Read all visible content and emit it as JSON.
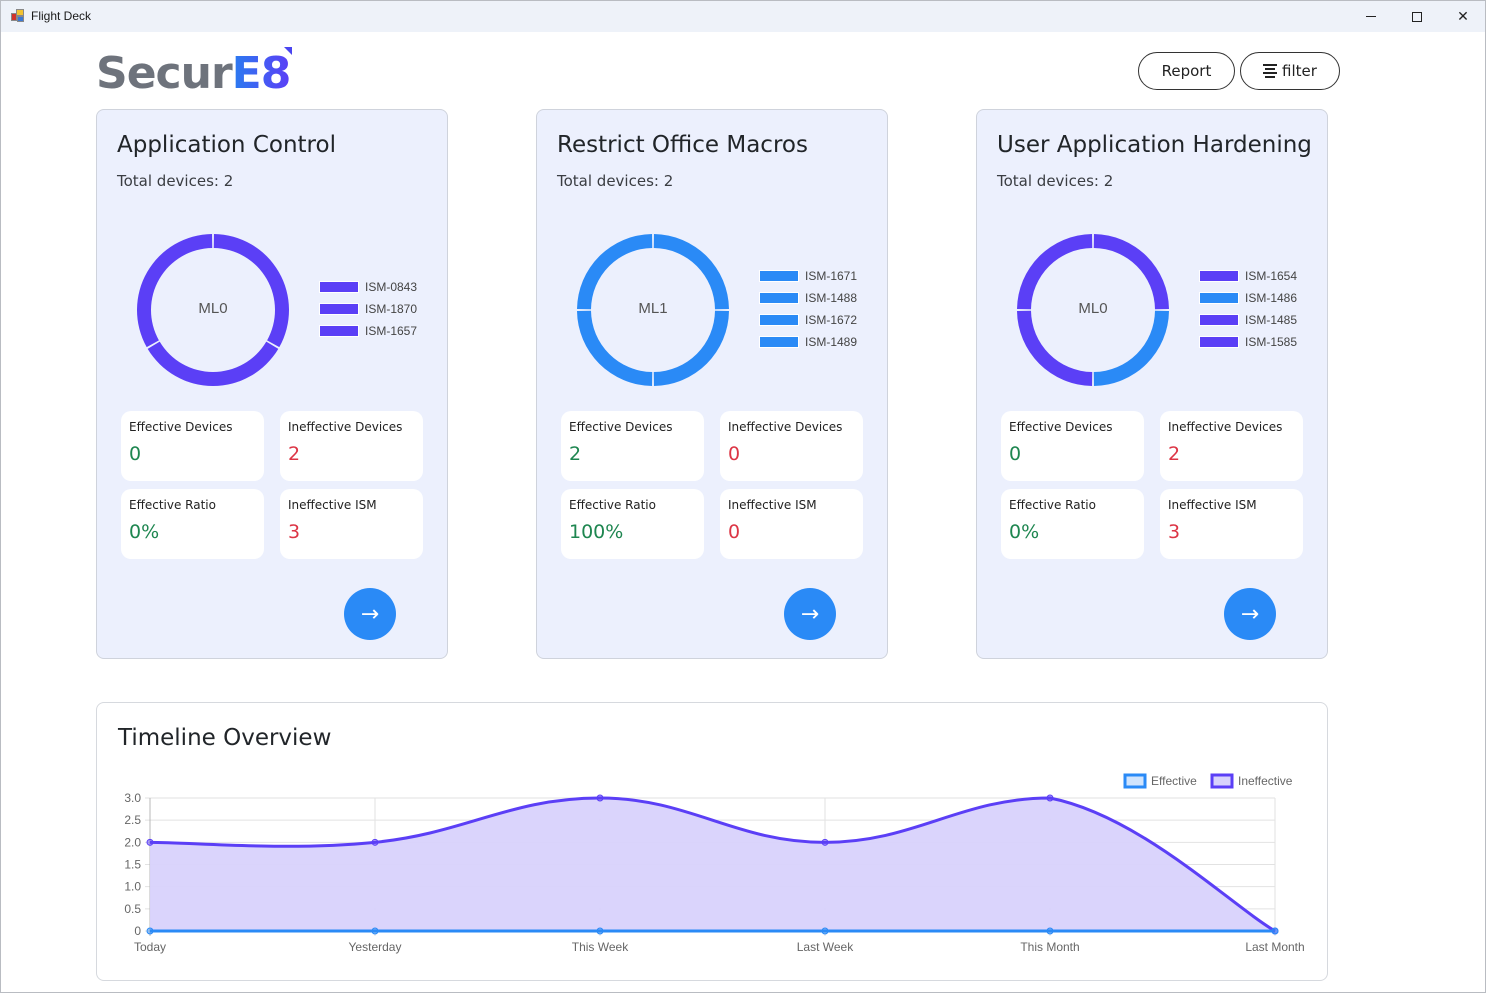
{
  "window": {
    "title": "Flight Deck",
    "controls": {
      "minimize": "minimize",
      "maximize": "maximize",
      "close": "close"
    }
  },
  "header": {
    "logo": {
      "part1": "Secur",
      "part2": "E8"
    },
    "report_label": "Report",
    "filter_label": "filter"
  },
  "colors": {
    "purple": "#5b3ff6",
    "blue": "#2a8af6",
    "good": "#1e8650",
    "bad": "#dc3545",
    "card_bg": "#ecf0fd"
  },
  "cards": [
    {
      "title": "Application Control",
      "total_devices": "Total devices: 2",
      "maturity_level": "ML0",
      "segments": [
        {
          "label": "ISM-0843",
          "color": "#5b3ff6"
        },
        {
          "label": "ISM-1870",
          "color": "#5b3ff6"
        },
        {
          "label": "ISM-1657",
          "color": "#5b3ff6"
        }
      ],
      "stats": {
        "effective_devices": {
          "label": "Effective Devices",
          "value": "0"
        },
        "ineffective_devices": {
          "label": "Ineffective Devices",
          "value": "2"
        },
        "effective_ratio": {
          "label": "Effective Ratio",
          "value": "0%"
        },
        "ineffective_ism": {
          "label": "Ineffective ISM",
          "value": "3"
        }
      },
      "go_icon": "arrow-right"
    },
    {
      "title": "Restrict Office Macros",
      "total_devices": "Total devices: 2",
      "maturity_level": "ML1",
      "segments": [
        {
          "label": "ISM-1671",
          "color": "#2a8af6"
        },
        {
          "label": "ISM-1488",
          "color": "#2a8af6"
        },
        {
          "label": "ISM-1672",
          "color": "#2a8af6"
        },
        {
          "label": "ISM-1489",
          "color": "#2a8af6"
        }
      ],
      "stats": {
        "effective_devices": {
          "label": "Effective Devices",
          "value": "2"
        },
        "ineffective_devices": {
          "label": "Ineffective Devices",
          "value": "0"
        },
        "effective_ratio": {
          "label": "Effective Ratio",
          "value": "100%"
        },
        "ineffective_ism": {
          "label": "Ineffective ISM",
          "value": "0"
        }
      },
      "go_icon": "arrow-right"
    },
    {
      "title": "User Application Hardening",
      "total_devices": "Total devices: 2",
      "maturity_level": "ML0",
      "segments": [
        {
          "label": "ISM-1654",
          "color": "#5b3ff6"
        },
        {
          "label": "ISM-1486",
          "color": "#2a8af6"
        },
        {
          "label": "ISM-1485",
          "color": "#5b3ff6"
        },
        {
          "label": "ISM-1585",
          "color": "#5b3ff6"
        }
      ],
      "stats": {
        "effective_devices": {
          "label": "Effective Devices",
          "value": "0"
        },
        "ineffective_devices": {
          "label": "Ineffective Devices",
          "value": "2"
        },
        "effective_ratio": {
          "label": "Effective Ratio",
          "value": "0%"
        },
        "ineffective_ism": {
          "label": "Ineffective ISM",
          "value": "3"
        }
      },
      "go_icon": "arrow-right"
    }
  ],
  "timeline": {
    "title": "Timeline Overview"
  },
  "chart_data": {
    "type": "area",
    "title": "Timeline Overview",
    "categories": [
      "Today",
      "Yesterday",
      "This Week",
      "Last Week",
      "This Month",
      "Last Month"
    ],
    "series": [
      {
        "name": "Effective",
        "values": [
          0,
          0,
          0,
          0,
          0,
          0
        ],
        "color": "#2a8af6",
        "fill": "#d0e4fd"
      },
      {
        "name": "Ineffective",
        "values": [
          2,
          2,
          3,
          2,
          3,
          0
        ],
        "color": "#5b3ff6",
        "fill": "#d8d2fc"
      }
    ],
    "yticks": [
      "0",
      "0.5",
      "1.0",
      "1.5",
      "2.0",
      "2.5",
      "3.0"
    ],
    "ylim": [
      0,
      3
    ],
    "xlabel": "",
    "ylabel": "",
    "grid": true,
    "legend": "top-right"
  }
}
